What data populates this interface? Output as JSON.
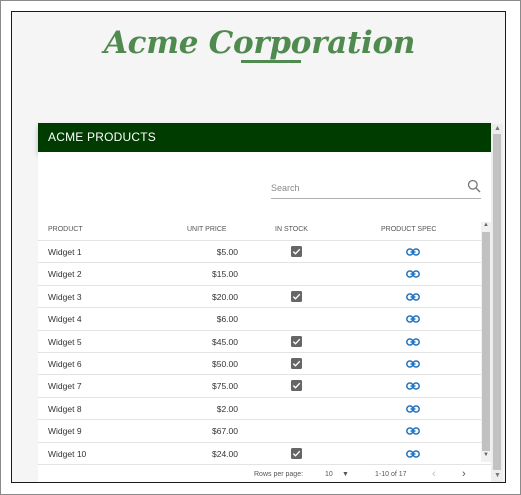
{
  "header": {
    "title": "Acme Corporation"
  },
  "card": {
    "title": "ACME PRODUCTS"
  },
  "search": {
    "placeholder": "Search",
    "value": ""
  },
  "columns": {
    "product": "PRODUCT",
    "unit_price": "UNIT PRICE",
    "in_stock": "IN STOCK",
    "product_spec": "PRODUCT SPEC"
  },
  "rows": [
    {
      "product": "Widget 1",
      "price": "$5.00",
      "in_stock": true
    },
    {
      "product": "Widget 2",
      "price": "$15.00",
      "in_stock": false
    },
    {
      "product": "Widget 3",
      "price": "$20.00",
      "in_stock": true
    },
    {
      "product": "Widget 4",
      "price": "$6.00",
      "in_stock": false
    },
    {
      "product": "Widget 5",
      "price": "$45.00",
      "in_stock": true
    },
    {
      "product": "Widget 6",
      "price": "$50.00",
      "in_stock": true
    },
    {
      "product": "Widget 7",
      "price": "$75.00",
      "in_stock": true
    },
    {
      "product": "Widget 8",
      "price": "$2.00",
      "in_stock": false
    },
    {
      "product": "Widget 9",
      "price": "$67.00",
      "in_stock": false
    },
    {
      "product": "Widget 10",
      "price": "$24.00",
      "in_stock": true
    }
  ],
  "pagination": {
    "rows_per_page_label": "Rows per page:",
    "rows_per_page": "10",
    "range": "1-10 of 17"
  },
  "colors": {
    "brand": "#4f8a4f",
    "header_bg": "#003b00",
    "link": "#1e73be",
    "checkbox": "#666666"
  },
  "icons": {
    "search": "search-icon",
    "stock": "checkbox-checked-icon",
    "spec": "link-icon",
    "prev": "chevron-left-icon",
    "next": "chevron-right-icon",
    "dropdown": "caret-down-icon"
  }
}
